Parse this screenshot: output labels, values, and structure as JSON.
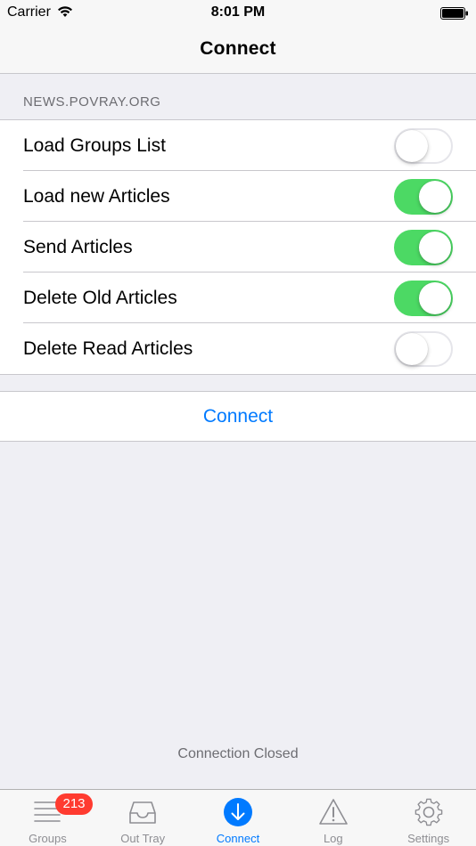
{
  "status_bar": {
    "carrier": "Carrier",
    "time": "8:01 PM"
  },
  "nav": {
    "title": "Connect"
  },
  "section": {
    "header": "NEWS.POVRAY.ORG"
  },
  "options": [
    {
      "label": "Load Groups List",
      "on": false
    },
    {
      "label": "Load new Articles",
      "on": true
    },
    {
      "label": "Send Articles",
      "on": true
    },
    {
      "label": "Delete Old Articles",
      "on": true
    },
    {
      "label": "Delete Read Articles",
      "on": false
    }
  ],
  "connect_button": {
    "label": "Connect"
  },
  "connection_status": "Connection Closed",
  "tabs": [
    {
      "label": "Groups",
      "icon": "list-icon",
      "badge": "213"
    },
    {
      "label": "Out Tray",
      "icon": "tray-icon"
    },
    {
      "label": "Connect",
      "icon": "download-circle-icon",
      "active": true
    },
    {
      "label": "Log",
      "icon": "warning-icon"
    },
    {
      "label": "Settings",
      "icon": "gear-icon"
    }
  ],
  "colors": {
    "accent": "#007aff",
    "switch_on": "#4cd964",
    "badge": "#ff3b30",
    "background": "#efeff4"
  }
}
